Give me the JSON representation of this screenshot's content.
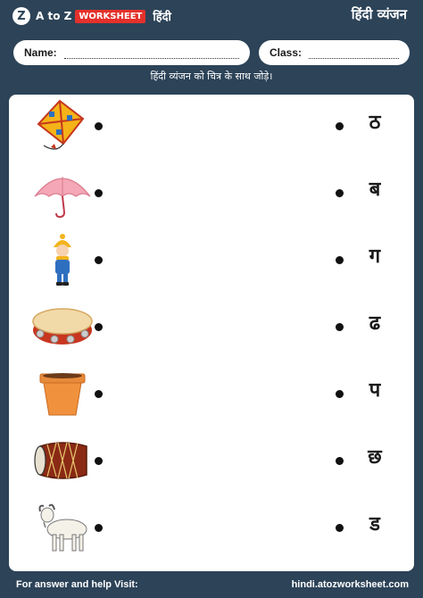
{
  "header": {
    "logo_letter": "Z",
    "logo_text": "A to Z",
    "logo_badge": "WORKSHEET",
    "logo_lang": "हिंदी",
    "title": "हिंदी व्यंजन"
  },
  "form": {
    "name_label": "Name:",
    "class_label": "Class:"
  },
  "instruction": "हिंदी व्यंजन को चित्र के साथ जोड़े।",
  "pictures": [
    {
      "name": "kite",
      "icon": "kite-icon"
    },
    {
      "name": "umbrella",
      "icon": "umbrella-icon"
    },
    {
      "name": "winter-child",
      "icon": "child-icon"
    },
    {
      "name": "tambourine",
      "icon": "tambourine-icon"
    },
    {
      "name": "flower-pot",
      "icon": "pot-icon"
    },
    {
      "name": "dholak",
      "icon": "drum-icon"
    },
    {
      "name": "goat",
      "icon": "goat-icon"
    }
  ],
  "letters": [
    "ठ",
    "ब",
    "ग",
    "ढ",
    "प",
    "छ",
    "ड"
  ],
  "footer": {
    "help_text": "For answer and help Visit:",
    "website": "hindi.atozworksheet.com"
  },
  "colors": {
    "background": "#2c4358",
    "card": "#ffffff",
    "brand_red": "#e4312b"
  }
}
